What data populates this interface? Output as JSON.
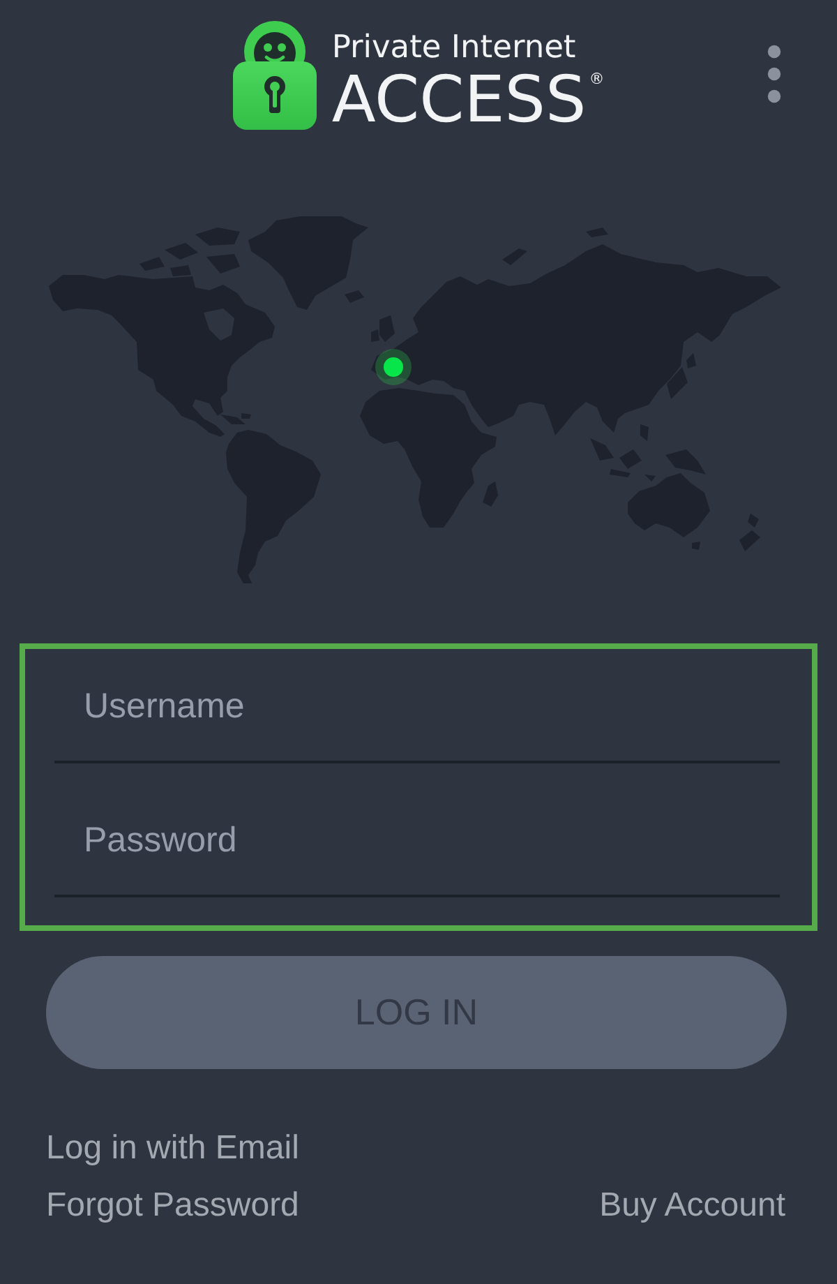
{
  "header": {
    "brand_line_1": "Private Internet",
    "brand_line_2": "ACCESS$^{®}$"
  },
  "login_form": {
    "highlighted": true,
    "fields": [
      {
        "placeholder": "Username"
      },
      {
        "placeholder": "Password"
      }
    ]
  },
  "login_button": {
    "label": "LOG IN",
    "disabled": true
  },
  "link_rows": [
    {
      "left": "Log in with Email"
    },
    {
      "left": "Forgot Password",
      "right": "Buy Account"
    }
  ]
}
